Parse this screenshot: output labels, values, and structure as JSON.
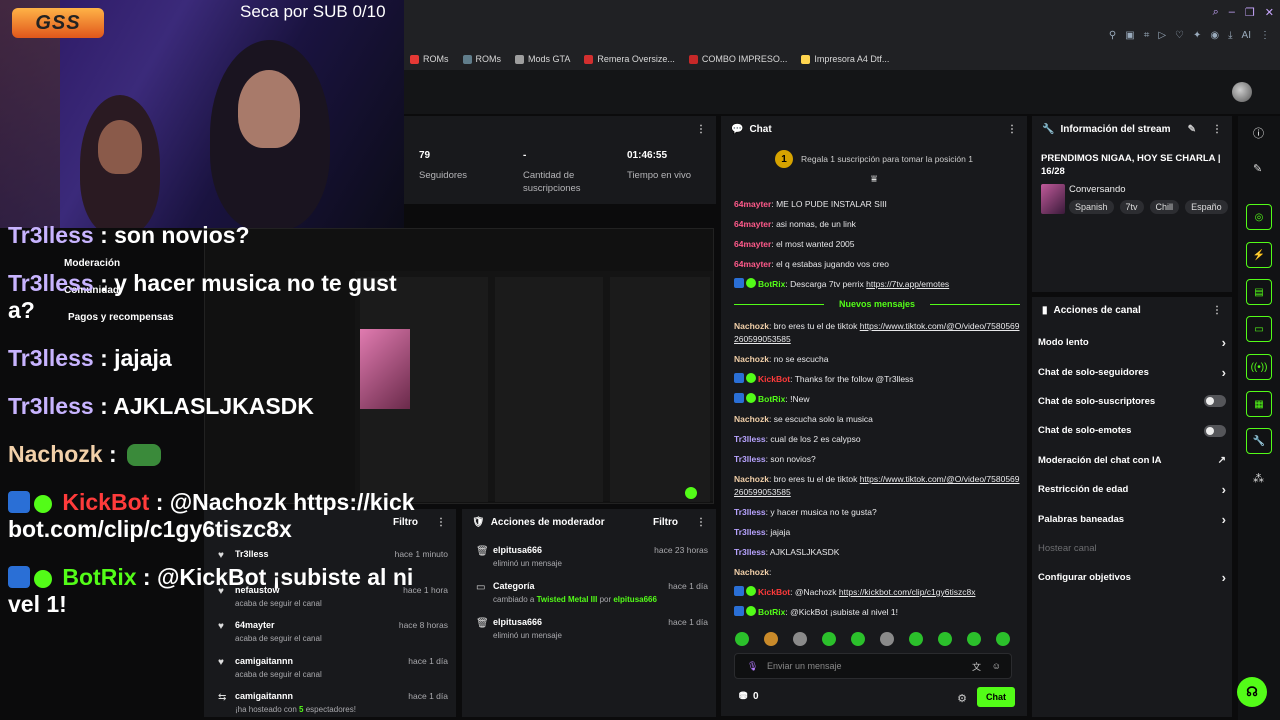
{
  "stream_overlay": {
    "logo": "GSS",
    "sub_goal": "Seca por SUB 0/10",
    "chat": [
      {
        "user": "Tr3lless",
        "text": ": son novios?"
      },
      {
        "user": "Tr3lless",
        "text": ": y hacer musica no te gusta?"
      },
      {
        "user": "Tr3lless",
        "text": ": jajaja"
      },
      {
        "user": "Tr3lless",
        "text": ": AJKLASLJKASDK"
      },
      {
        "user": "Nachozk",
        "text": ":"
      },
      {
        "user": "KickBot",
        "text": ": @Nachozk https://kickbot.com/clip/c1gy6tiszc8x"
      },
      {
        "user": "BotRix",
        "text": ": @KickBot ¡subiste al nivel 1!"
      }
    ],
    "sidebar_nav": [
      "Moderación",
      "Comunidad",
      "Pagos y recompensas"
    ]
  },
  "bookmarks": [
    "ROMs",
    "ROMs",
    "Mods GTA",
    "Remera Oversize...",
    "COMBO IMPRESO...",
    "Impresora A4 Dtf..."
  ],
  "stats": {
    "followers": {
      "value": "79",
      "label": "Seguidores"
    },
    "subs": {
      "value": "-",
      "label": "Cantidad de suscripciones"
    },
    "uptime": {
      "value": "01:46:55",
      "label": "Tiempo en vivo"
    }
  },
  "chat": {
    "title": "Chat",
    "gift_rank": "1",
    "gift_text": "Regala 1 suscripción para tomar la posición 1",
    "new_messages": "Nuevos mensajes",
    "messages_before": [
      {
        "user": "64mayter",
        "color": "#ff5a8a",
        "text": ": ME LO PUDE INSTALAR SIII"
      },
      {
        "user": "64mayter",
        "color": "#ff5a8a",
        "text": ": asi nomas, de un link"
      },
      {
        "user": "64mayter",
        "color": "#ff5a8a",
        "text": ": el most wanted 2005"
      },
      {
        "user": "64mayter",
        "color": "#ff5a8a",
        "text": ": el q estabas jugando vos creo"
      },
      {
        "user": "BotRix",
        "color": "#53fc18",
        "text": ": Descarga 7tv perrix ",
        "link": "https://7tv.app/emotes"
      }
    ],
    "messages_after": [
      {
        "user": "Nachozk",
        "color": "#f2d0a9",
        "text": ": bro eres tu el de tiktok ",
        "link": "https://www.tiktok.com/@O/video/7580569260599053585"
      },
      {
        "user": "Nachozk",
        "color": "#f2d0a9",
        "text": ": no se escucha"
      },
      {
        "user": "KickBot",
        "color": "#ff3b3b",
        "text": ": Thanks for the follow @Tr3lless"
      },
      {
        "user": "BotRix",
        "color": "#53fc18",
        "text": ": !New"
      },
      {
        "user": "Nachozk",
        "color": "#f2d0a9",
        "text": ": se escucha solo la musica"
      },
      {
        "user": "Tr3lless",
        "color": "#b8a4ff",
        "text": ": cual de los 2 es calypso"
      },
      {
        "user": "Tr3lless",
        "color": "#b8a4ff",
        "text": ": son novios?"
      },
      {
        "user": "Nachozk",
        "color": "#f2d0a9",
        "text": ": bro eres tu el de tiktok ",
        "link": "https://www.tiktok.com/@O/video/7580569260599053585"
      },
      {
        "user": "Tr3lless",
        "color": "#b8a4ff",
        "text": ": y hacer musica no te gusta?"
      },
      {
        "user": "Tr3lless",
        "color": "#b8a4ff",
        "text": ": jajaja"
      },
      {
        "user": "Tr3lless",
        "color": "#b8a4ff",
        "text": ": AJKLASLJKASDK"
      },
      {
        "user": "Nachozk",
        "color": "#f2d0a9",
        "text": ":"
      },
      {
        "user": "KickBot",
        "color": "#ff3b3b",
        "text": ": @Nachozk ",
        "link": "https://kickbot.com/clip/c1gy6tiszc8x"
      },
      {
        "user": "BotRix",
        "color": "#53fc18",
        "text": ": @KickBot ¡subiste al nivel 1!"
      }
    ],
    "input_placeholder": "Enviar un mensaje",
    "points": "0",
    "send_label": "Chat"
  },
  "stream_info": {
    "title": "Información del stream",
    "stream_title": "PRENDIMOS NIGAA, HOY SE CHARLA | 16/28",
    "category": "Conversando",
    "tags": [
      "Spanish",
      "7tv",
      "Chill",
      "Españo"
    ]
  },
  "channel_actions": {
    "title": "Acciones de canal",
    "items": [
      {
        "label": "Modo lento",
        "kind": "chevron"
      },
      {
        "label": "Chat de solo-seguidores",
        "kind": "chevron"
      },
      {
        "label": "Chat de solo-suscriptores",
        "kind": "toggle"
      },
      {
        "label": "Chat de solo-emotes",
        "kind": "toggle"
      },
      {
        "label": "Moderación del chat con IA",
        "kind": "external"
      },
      {
        "label": "Restricción de edad",
        "kind": "chevron"
      },
      {
        "label": "Palabras baneadas",
        "kind": "chevron"
      },
      {
        "label": "Hostear canal",
        "kind": "disabled"
      },
      {
        "label": "Configurar objetivos",
        "kind": "chevron"
      }
    ]
  },
  "activity": {
    "filter_label": "Filtro",
    "rows": [
      {
        "name": "Tr3lless",
        "sub": "",
        "time": "hace 1 minuto"
      },
      {
        "name": "nefaustow",
        "sub": "acaba de seguir el canal",
        "time": "hace 1 hora"
      },
      {
        "name": "64mayter",
        "sub": "acaba de seguir el canal",
        "time": "hace 8 horas"
      },
      {
        "name": "camigaitannn",
        "sub": "acaba de seguir el canal",
        "time": "hace 1 día"
      },
      {
        "name": "camigaitannn",
        "sub_prefix": "¡ha hosteado con ",
        "sub_num": "5",
        "sub_suffix": " espectadores!",
        "time": "hace 1 día"
      }
    ]
  },
  "mod_actions": {
    "title": "Acciones de moderador",
    "filter_label": "Filtro",
    "rows": [
      {
        "name": "elpitusa666",
        "sub": "eliminó un mensaje",
        "time": "hace 23 horas"
      },
      {
        "name": "Categoría",
        "sub_prefix": "cambiado a ",
        "sub_cat": "Twisted Metal III",
        "sub_mid": " por ",
        "sub_by": "elpitusa666",
        "time": "hace 1 día"
      },
      {
        "name": "elpitusa666",
        "sub": "eliminó un mensaje",
        "time": "hace 1 día"
      }
    ]
  }
}
